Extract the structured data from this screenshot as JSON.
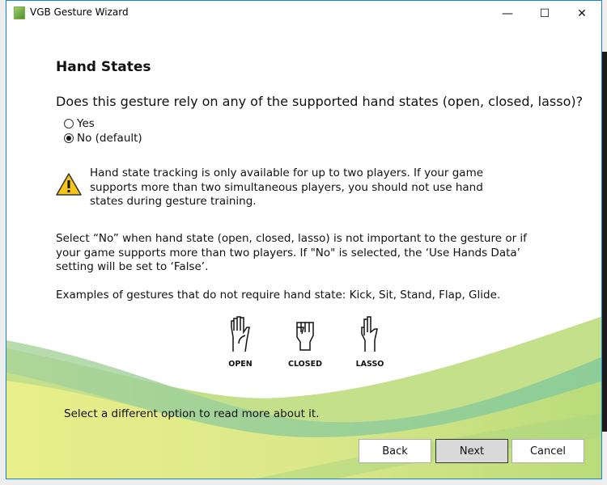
{
  "window": {
    "title": "VGB Gesture Wizard",
    "minimize": "—",
    "maximize": "☐",
    "close": "✕"
  },
  "page": {
    "heading": "Hand States",
    "question": "Does this gesture rely on any of the supported hand states (open, closed, lasso)?",
    "options": [
      {
        "label": "Yes",
        "selected": false
      },
      {
        "label": "No (default)",
        "selected": true
      }
    ],
    "warning": "Hand state tracking is only available for up to two players. If your game supports more than two simultaneous players, you should not use hand states during gesture training.",
    "info": "Select “No” when hand state (open, closed, lasso) is not important to the gesture or if your game supports more than two players. If \"No\" is selected, the ‘Use Hands Data’ setting will be set to ‘False’.",
    "examples": "Examples of gestures that do not require hand state: Kick, Sit, Stand, Flap, Glide.",
    "hands": [
      "OPEN",
      "CLOSED",
      "LASSO"
    ],
    "footer": "Select a different option to read more about it."
  },
  "buttons": {
    "back": "Back",
    "next": "Next",
    "cancel": "Cancel"
  }
}
